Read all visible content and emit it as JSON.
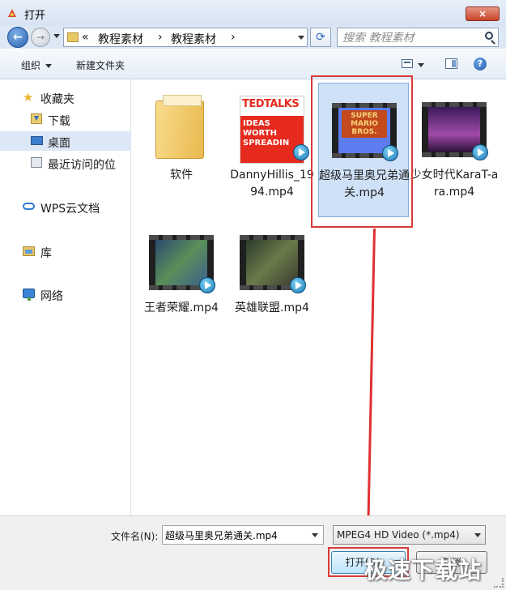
{
  "window": {
    "title": "打开",
    "close_label": "×"
  },
  "address": {
    "prefix": "«",
    "crumbs": [
      "教程素材",
      "教程素材"
    ],
    "separator": "›",
    "search_placeholder": "搜索 教程素材"
  },
  "toolbar": {
    "organize_label": "组织",
    "new_folder_label": "新建文件夹",
    "help_label": "?"
  },
  "sidebar": {
    "items": [
      {
        "label": "收藏夹",
        "icon": "star-icon"
      },
      {
        "label": "下载",
        "icon": "download-folder-icon"
      },
      {
        "label": "桌面",
        "icon": "desktop-icon"
      },
      {
        "label": "最近访问的位",
        "icon": "recent-places-icon"
      },
      {
        "label": "WPS云文档",
        "icon": "cloud-icon"
      },
      {
        "label": "库",
        "icon": "library-icon"
      },
      {
        "label": "网络",
        "icon": "network-icon"
      }
    ]
  },
  "files": [
    {
      "name": "软件",
      "type": "folder"
    },
    {
      "name": "DannyHillis_1994.mp4",
      "type": "video",
      "thumb_heading": "TEDTALKS",
      "thumb_text": "IDEAS WORTH SPREADIN"
    },
    {
      "name": "超级马里奥兄弟通关.mp4",
      "type": "video",
      "selected": true,
      "thumb_text": "SUPER MARIO BROS."
    },
    {
      "name": "少女时代KaraT-ara.mp4",
      "type": "video"
    },
    {
      "name": "王者荣耀.mp4",
      "type": "video"
    },
    {
      "name": "英雄联盟.mp4",
      "type": "video"
    }
  ],
  "bottom": {
    "filename_label": "文件名(N):",
    "filename_value": "超级马里奥兄弟通关.mp4",
    "filetype_value": "MPEG4 HD Video (*.mp4)",
    "open_label": "打开(O)",
    "cancel_label": "取消"
  },
  "watermark": "极速下载站",
  "colors": {
    "highlight_red": "#d93a3a",
    "selection_blue": "#cfe1f7"
  }
}
